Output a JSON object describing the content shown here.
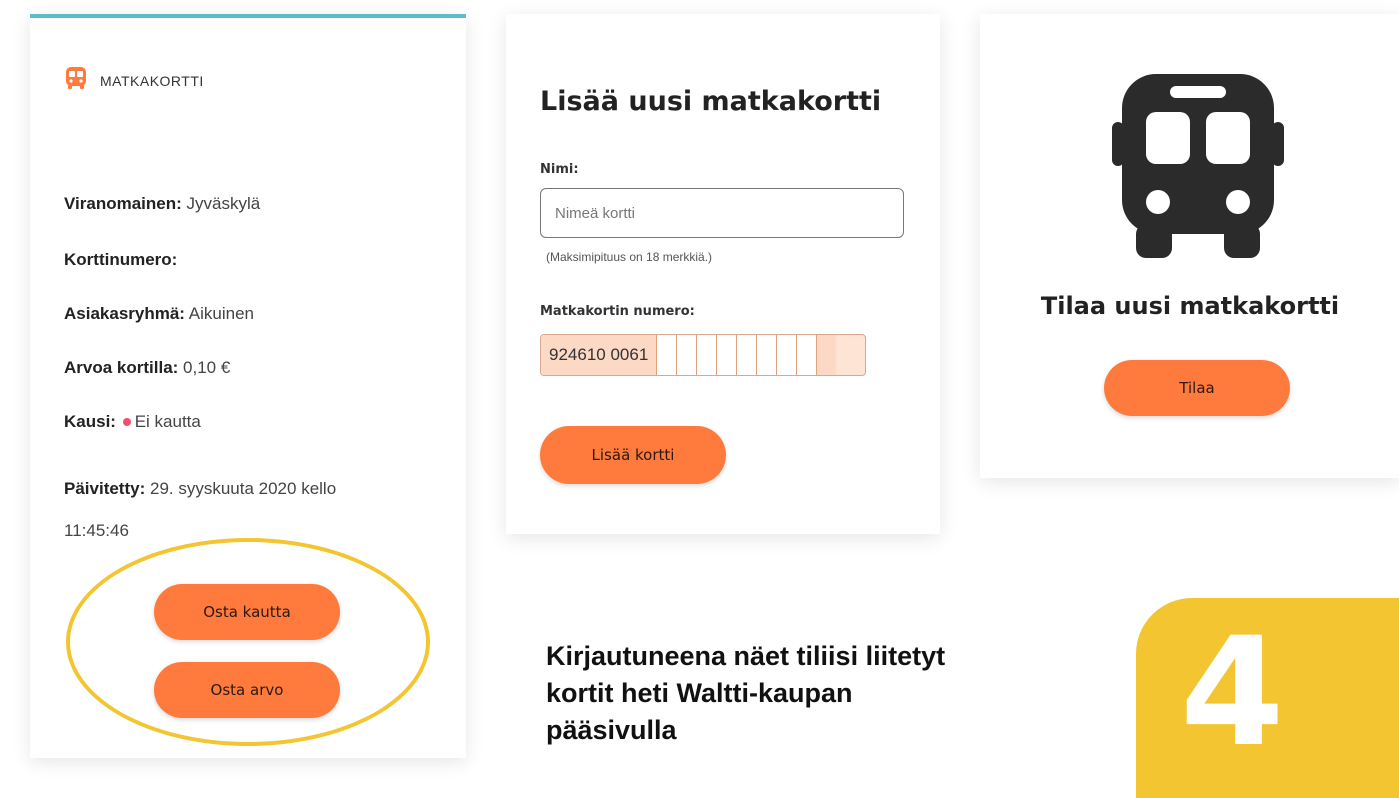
{
  "card_travel": {
    "label": "MATKAKORTTI",
    "authority_label": "Viranomainen:",
    "authority_value": "Jyväskylä",
    "number_label": "Korttinumero:",
    "group_label": "Asiakasryhmä:",
    "group_value": "Aikuinen",
    "balance_label": "Arvoa kortilla:",
    "balance_value": "0,10 €",
    "season_label": "Kausi:",
    "season_value": "Ei kautta",
    "updated_label": "Päivitetty:",
    "updated_value_line1": "29. syyskuuta 2020 kello",
    "updated_value_line2": "11:45:46",
    "buy_season_label": "Osta kautta",
    "buy_value_label": "Osta arvo"
  },
  "card_add": {
    "title": "Lisää uusi matkakortti",
    "name_label": "Nimi:",
    "name_placeholder": "Nimeä kortti",
    "name_hint": "(Maksimipituus on 18 merkkiä.)",
    "number_label": "Matkakortin numero:",
    "number_value": "924610 0061",
    "add_button_label": "Lisää kortti"
  },
  "card_order": {
    "title": "Tilaa uusi matkakortti",
    "order_button_label": "Tilaa",
    "icon": "bus-icon"
  },
  "caption": {
    "line1": "Kirjautuneena näet tiliisi liitetyt",
    "line2": "kortit heti Waltti-kaupan",
    "line3": "pääsivulla"
  },
  "step_number": "4",
  "colors": {
    "accent_orange": "#ff7a3d",
    "highlight_yellow": "#f3c531",
    "top_border_teal": "#5bbdc9"
  }
}
